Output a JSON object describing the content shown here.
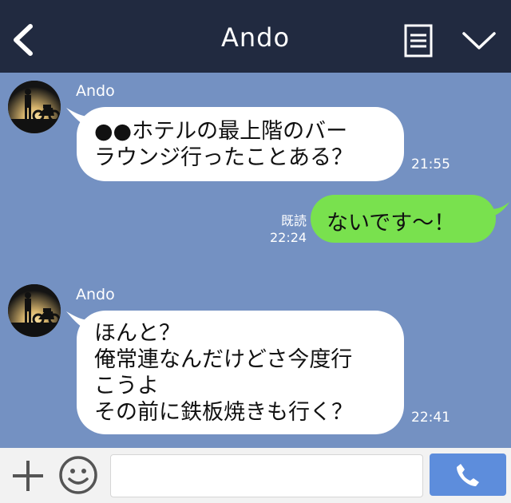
{
  "header": {
    "title": "Ando",
    "icons": [
      "back-chevron-icon",
      "note-icon",
      "dropdown-chevron-icon"
    ]
  },
  "messages": [
    {
      "sender": "Ando",
      "text": "●●ホテルの最上階のバー\nラウンジ行ったことある？",
      "time": "21:55",
      "direction": "incoming"
    },
    {
      "text": "ないです〜！",
      "time": "22:24",
      "read_label": "既読",
      "direction": "outgoing"
    },
    {
      "sender": "Ando",
      "text": "ほんと？\n俺常連なんだけどさ今度行\nこうよ\nその前に鉄板焼きも行く？",
      "time": "22:41",
      "direction": "incoming"
    }
  ],
  "footer": {
    "input_value": "",
    "icons": [
      "plus-icon",
      "smiley-icon",
      "phone-icon"
    ]
  },
  "colors": {
    "header_bg": "#212a40",
    "chat_bg": "#7491c2",
    "outgoing_bubble": "#79e14e",
    "incoming_bubble": "#ffffff",
    "send_button": "#5d8ddc"
  }
}
